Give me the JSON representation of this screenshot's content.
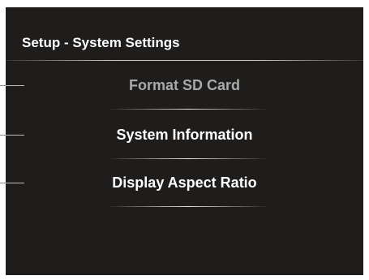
{
  "screen": {
    "title": "Setup - System Settings"
  },
  "menu": {
    "items": [
      {
        "label": "Format SD Card",
        "state": "disabled"
      },
      {
        "label": "System Information",
        "state": "enabled"
      },
      {
        "label": "Display Aspect Ratio",
        "state": "enabled"
      }
    ]
  },
  "colors": {
    "background": "#1f1d1c",
    "text": "#ffffff",
    "text_disabled": "#a9a9a9"
  }
}
